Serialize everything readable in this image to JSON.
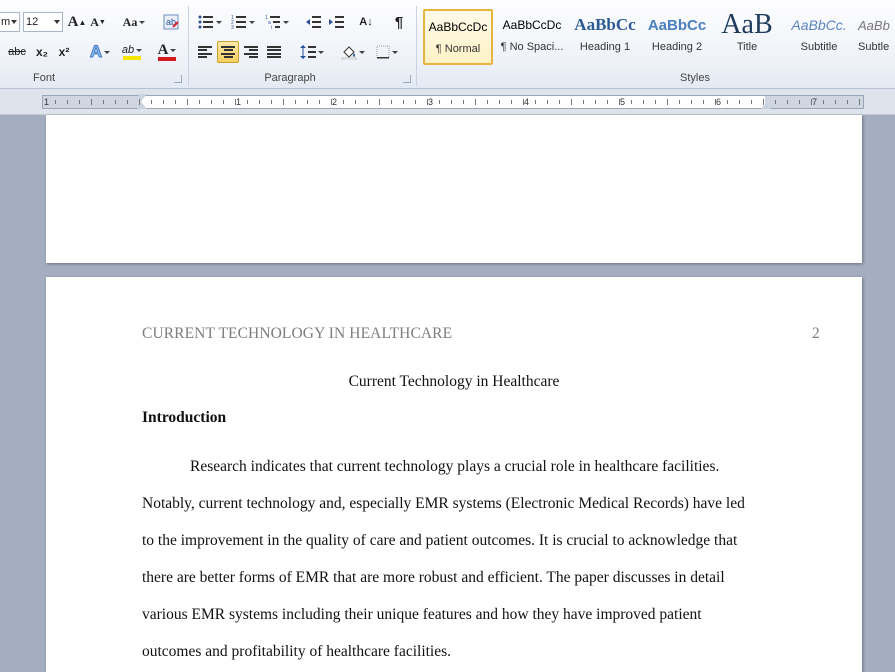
{
  "ribbon": {
    "font": {
      "font_name_value": "m",
      "font_size_value": "12",
      "group_label": "Font",
      "grow_font_label": "A",
      "shrink_font_label": "A",
      "change_case_label": "Aa",
      "strikethrough_label": "abc",
      "subscript_label": "x₂",
      "superscript_label": "x²",
      "text_effects_label": "A",
      "highlight_label": "ab",
      "font_color_label": "A",
      "highlight_color": "#f5e600",
      "font_color": "#d21818"
    },
    "paragraph": {
      "group_label": "Paragraph",
      "show_marks_label": "¶",
      "sort_label": "A↓"
    },
    "styles": {
      "group_label": "Styles",
      "items": [
        {
          "sample": "AaBbCcDc",
          "name": "¶ Normal"
        },
        {
          "sample": "AaBbCcDc",
          "name": "¶ No Spaci..."
        },
        {
          "sample": "AaBbCc",
          "name": "Heading 1"
        },
        {
          "sample": "AaBbCc",
          "name": "Heading 2"
        },
        {
          "sample": "AaB",
          "name": "Title"
        },
        {
          "sample": "AaBbCc.",
          "name": "Subtitle"
        },
        {
          "sample": "AaBb",
          "name": "Subtle"
        }
      ]
    }
  },
  "ruler": {
    "numbers": [
      "1",
      "1",
      "2",
      "3",
      "4",
      "5",
      "6",
      "7"
    ]
  },
  "document": {
    "running_head": "CURRENT TECHNOLOGY IN HEALTHCARE",
    "page_number": "2",
    "title": "Current Technology in Healthcare",
    "heading": "Introduction",
    "lines": [
      "Research indicates that current technology plays a crucial role in healthcare facilities.",
      "Notably, current technology and, especially EMR systems (Electronic Medical Records) have led",
      "to the improvement in the quality of care and patient outcomes. It is crucial to acknowledge that",
      "there are better forms of EMR that are more robust and efficient. The paper discusses in detail",
      "various EMR systems including their unique features and how they have improved patient",
      "outcomes and profitability of healthcare facilities."
    ]
  }
}
